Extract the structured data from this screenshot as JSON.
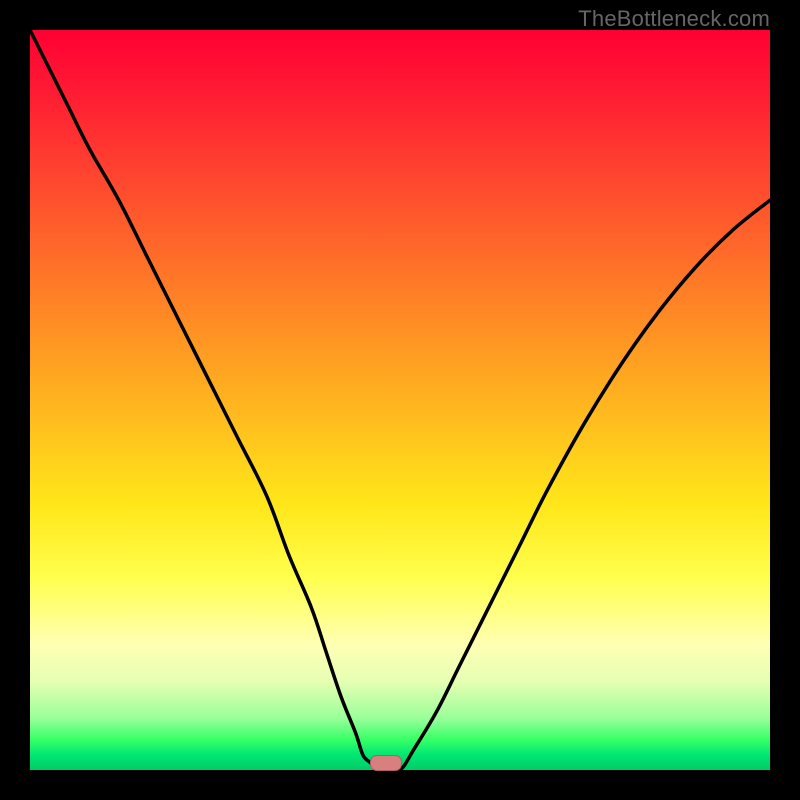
{
  "watermark": "TheBottleneck.com",
  "chart_data": {
    "type": "line",
    "title": "",
    "xlabel": "",
    "ylabel": "",
    "xlim": [
      0,
      100
    ],
    "ylim": [
      0,
      100
    ],
    "x": [
      0,
      2,
      5,
      8,
      12,
      16,
      20,
      24,
      28,
      32,
      35,
      38,
      40,
      42,
      44,
      45,
      46,
      47,
      48,
      50,
      52,
      55,
      58,
      62,
      66,
      70,
      75,
      80,
      85,
      90,
      95,
      100
    ],
    "values": [
      100,
      96,
      90,
      84,
      77,
      69,
      61,
      53,
      45,
      37,
      29,
      22,
      16,
      10,
      5,
      2,
      1,
      0,
      0,
      0,
      3,
      8,
      14,
      22,
      30,
      38,
      47,
      55,
      62,
      68,
      73,
      77
    ],
    "minimum_at_x": 48,
    "marker_at_x": 48,
    "background_gradient": {
      "top": "#ff0033",
      "middle": "#ffff4d",
      "bottom": "#00cc66"
    },
    "note": "V-shaped bottleneck curve; x-axis has no visible tick labels, y-axis has no visible tick labels; values estimated from pixel positions"
  }
}
